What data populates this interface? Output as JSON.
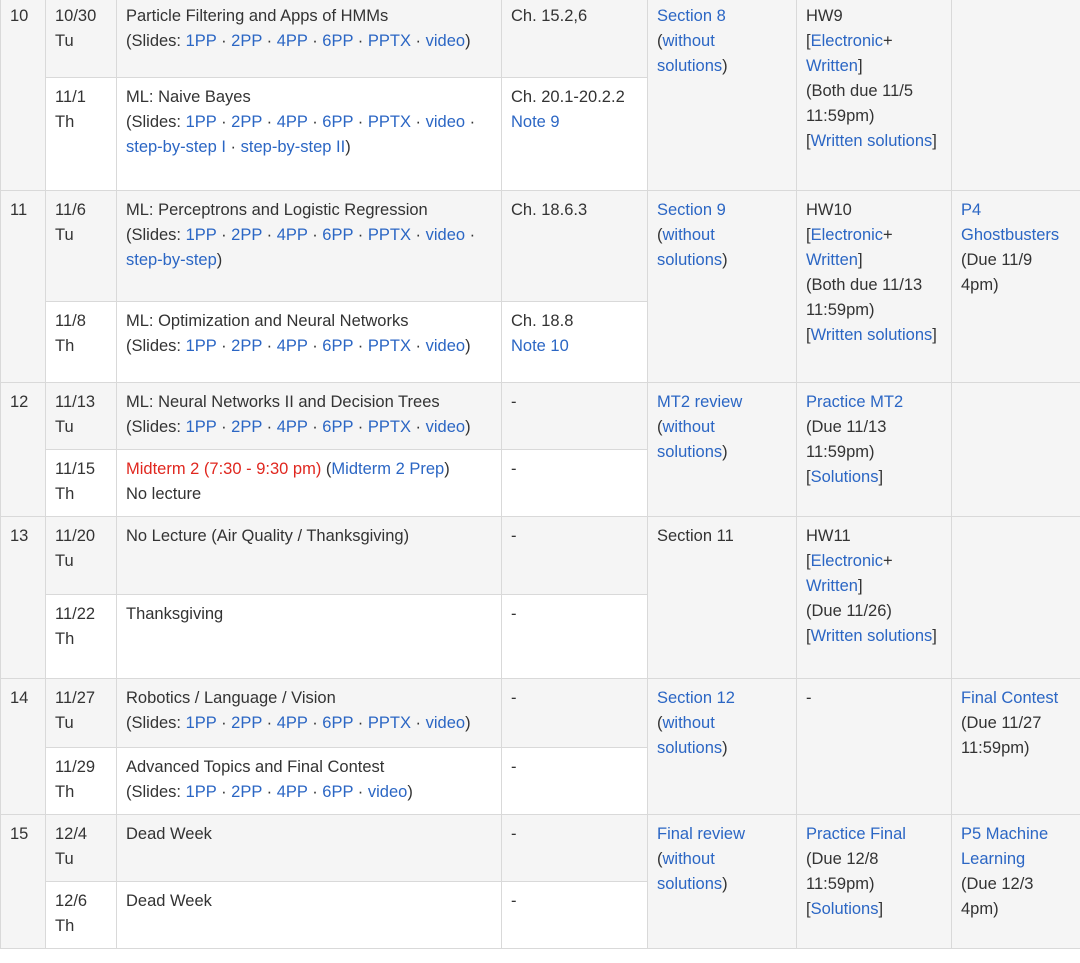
{
  "colors": {
    "link": "#2b66c4",
    "alert": "#e0271f",
    "stripe": "#f5f5f5",
    "border": "#d9d9d9"
  },
  "slides_label": "Slides:",
  "sep": "·",
  "weeks": [
    {
      "week": "10",
      "section": {
        "link": "Section 8",
        "note": "without solutions"
      },
      "hw": {
        "title": "HW9",
        "link_a": "Electronic",
        "link_b": "Written",
        "due": "(Both due 11/5 11:59pm)",
        "sol": "Written solutions"
      },
      "project": null,
      "rows": [
        {
          "date": "10/30",
          "day": "Tu",
          "title": "Particle Filtering and Apps of HMMs",
          "slides": [
            "1PP",
            "2PP",
            "4PP",
            "6PP",
            "PPTX",
            "video"
          ],
          "reading": [
            "Ch. 15.2,6"
          ]
        },
        {
          "date": "11/1",
          "day": "Th",
          "title": "ML: Naive Bayes",
          "slides": [
            "1PP",
            "2PP",
            "4PP",
            "6PP",
            "PPTX",
            "video",
            "step-by-step I",
            "step-by-step II"
          ],
          "reading": [
            "Ch. 20.1-20.2.2"
          ],
          "note_link": "Note 9"
        }
      ]
    },
    {
      "week": "11",
      "section": {
        "link": "Section 9",
        "note": "without solutions"
      },
      "hw": {
        "title": "HW10",
        "link_a": "Electronic",
        "link_b": "Written",
        "due": "(Both due 11/13 11:59pm)",
        "sol": "Written solutions"
      },
      "project": {
        "link": "P4 Ghostbusters",
        "due": "(Due 11/9 4pm)"
      },
      "rows": [
        {
          "date": "11/6",
          "day": "Tu",
          "title": "ML: Perceptrons and Logistic Regression",
          "slides": [
            "1PP",
            "2PP",
            "4PP",
            "6PP",
            "PPTX",
            "video",
            "step-by-step"
          ],
          "reading": [
            "Ch. 18.6.3"
          ]
        },
        {
          "date": "11/8",
          "day": "Th",
          "title": "ML: Optimization and Neural Networks",
          "slides": [
            "1PP",
            "2PP",
            "4PP",
            "6PP",
            "PPTX",
            "video"
          ],
          "reading": [
            "Ch. 18.8"
          ],
          "note_link": "Note 10"
        }
      ]
    },
    {
      "week": "12",
      "section": {
        "link": "MT2 review",
        "note": "without solutions"
      },
      "hw": {
        "link_title": "Practice MT2",
        "due": "(Due 11/13 11:59pm)",
        "sol": "Solutions"
      },
      "rows": [
        {
          "date": "11/13",
          "day": "Tu",
          "title": "ML: Neural Networks II and Decision Trees",
          "slides": [
            "1PP",
            "2PP",
            "4PP",
            "6PP",
            "PPTX",
            "video"
          ],
          "reading": [
            "-"
          ]
        },
        {
          "date": "11/15",
          "day": "Th",
          "midterm": "Midterm 2 (7:30 - 9:30 pm)",
          "midterm_prep": "Midterm 2 Prep",
          "subtitle": "No lecture",
          "reading": [
            "-"
          ]
        }
      ]
    },
    {
      "week": "13",
      "section": {
        "text": "Section 11"
      },
      "hw": {
        "title": "HW11",
        "link_a": "Electronic",
        "link_b": "Written",
        "due": "(Due 11/26)",
        "sol": "Written solutions"
      },
      "rows": [
        {
          "date": "11/20",
          "day": "Tu",
          "title": "No Lecture (Air Quality / Thanksgiving)",
          "reading": [
            "-"
          ]
        },
        {
          "date": "11/22",
          "day": "Th",
          "title": "Thanksgiving",
          "reading": [
            "-"
          ]
        }
      ]
    },
    {
      "week": "14",
      "section": {
        "link": "Section 12",
        "note": "without solutions"
      },
      "hw": {
        "text": "-"
      },
      "project": {
        "link": "Final Contest",
        "due": "(Due 11/27 11:59pm)"
      },
      "rows": [
        {
          "date": "11/27",
          "day": "Tu",
          "title": "Robotics / Language / Vision",
          "slides": [
            "1PP",
            "2PP",
            "4PP",
            "6PP",
            "PPTX",
            "video"
          ],
          "reading": [
            "-"
          ]
        },
        {
          "date": "11/29",
          "day": "Th",
          "title": "Advanced Topics and Final Contest",
          "slides": [
            "1PP",
            "2PP",
            "4PP",
            "6PP",
            "video"
          ],
          "reading": [
            "-"
          ]
        }
      ]
    },
    {
      "week": "15",
      "section": {
        "link": "Final review",
        "note": "without solutions"
      },
      "hw": {
        "link_title": "Practice Final",
        "due": "(Due 12/8 11:59pm)",
        "sol": "Solutions"
      },
      "project": {
        "link": "P5 Machine Learning",
        "due": "(Due 12/3 4pm)"
      },
      "rows": [
        {
          "date": "12/4",
          "day": "Tu",
          "title": "Dead Week",
          "reading": [
            "-"
          ]
        },
        {
          "date": "12/6",
          "day": "Th",
          "title": "Dead Week",
          "reading": [
            "-"
          ]
        }
      ]
    }
  ]
}
